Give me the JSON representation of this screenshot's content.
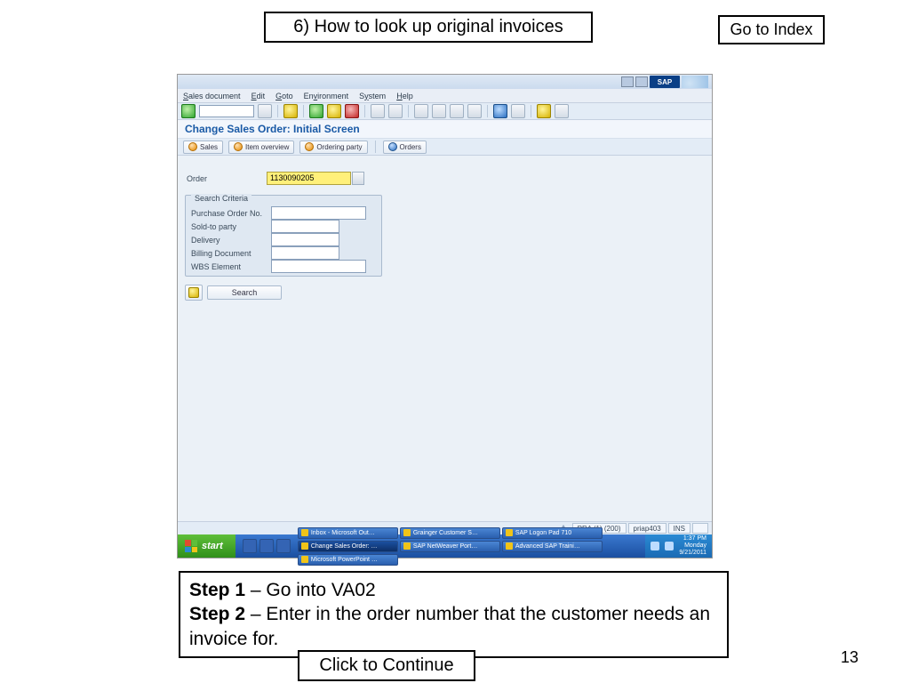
{
  "title": "6) How to look up original invoices",
  "index_label": "Go to Index",
  "step_callout": "Step 2",
  "instructions": {
    "step1_label": "Step 1",
    "step1_text": " – Go into VA02",
    "step2_label": "Step 2",
    "step2_text": " – Enter in the order number that the customer needs an invoice for."
  },
  "continue_label": "Click to Continue",
  "page_number": "13",
  "sap": {
    "logo": "SAP",
    "menu": {
      "sales_doc": "Sales document",
      "edit": "Edit",
      "goto": "Goto",
      "environment": "Environment",
      "system": "System",
      "help": "Help"
    },
    "screen_title": "Change Sales Order: Initial Screen",
    "buttons": {
      "sales": "Sales",
      "item_overview": "Item overview",
      "ordering_party": "Ordering party",
      "orders": "Orders"
    },
    "fields": {
      "order_label": "Order",
      "order_value": "1130090205",
      "group_title": "Search Criteria",
      "po_label": "Purchase Order No.",
      "soldto_label": "Sold-to party",
      "delivery_label": "Delivery",
      "billing_label": "Billing Document",
      "wbs_label": "WBS Element",
      "search_label": "Search"
    },
    "status": {
      "session": "PRA (1) (200)",
      "server": "priap403",
      "ins": "INS"
    }
  },
  "taskbar": {
    "start": "start",
    "items": {
      "inbox": "Inbox - Microsoft Out…",
      "grainger": "Grainger Customer S…",
      "logon": "SAP Logon Pad 710",
      "change": "Change Sales Order: …",
      "netweaver": "SAP NetWeaver Port…",
      "adv_sap": "Advanced SAP Traini…",
      "ppt": "Microsoft PowerPoint …"
    },
    "time": "1:37 PM",
    "day": "Monday",
    "date": "9/21/2011"
  }
}
